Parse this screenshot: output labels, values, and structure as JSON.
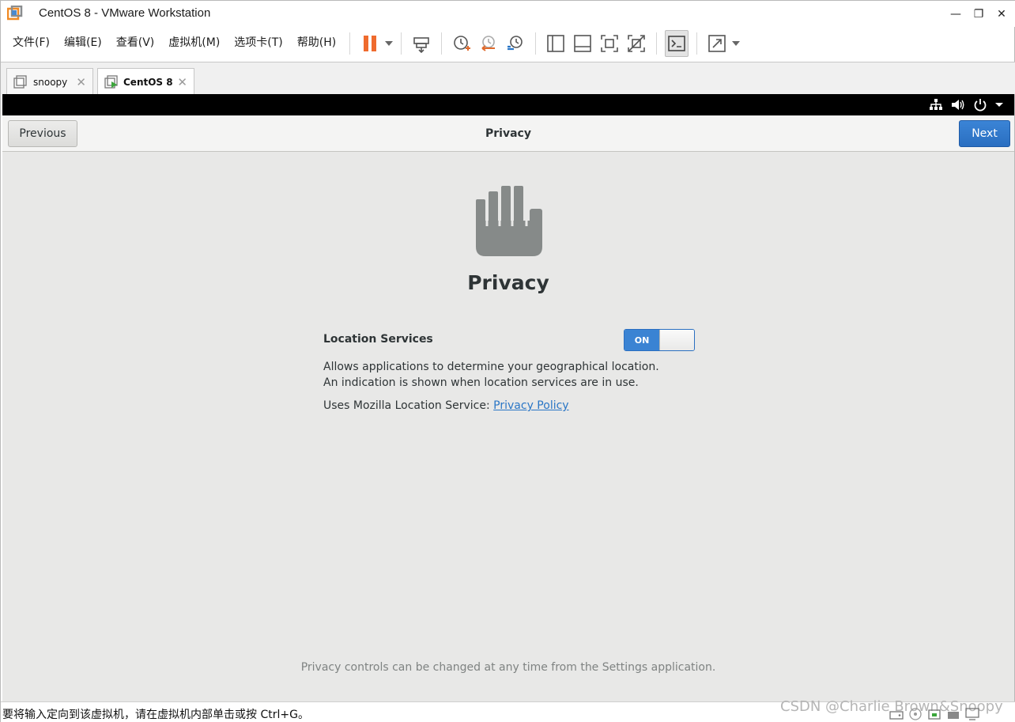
{
  "window": {
    "title": "CentOS 8 - VMware Workstation",
    "controls": {
      "minimize": "—",
      "restore": "❐",
      "close": "✕"
    }
  },
  "menu": [
    {
      "label": "文件(F)"
    },
    {
      "label": "编辑(E)"
    },
    {
      "label": "查看(V)"
    },
    {
      "label": "虚拟机(M)"
    },
    {
      "label": "选项卡(T)"
    },
    {
      "label": "帮助(H)"
    }
  ],
  "toolbar": {
    "icons": [
      "pause-icon",
      "send-keys-icon",
      "snapshot-icon",
      "revert-snapshot-icon",
      "snapshot-manager-icon",
      "show-library-icon",
      "show-thumbnails-icon",
      "fullscreen-icon",
      "unity-icon",
      "console-icon",
      "stretch-icon"
    ],
    "pause_color": "#ef6b2e",
    "snapshot_color": "#e06a2c"
  },
  "tabs": [
    {
      "label": "snoopy",
      "active": false
    },
    {
      "label": "CentOS 8",
      "active": true
    }
  ],
  "vm": {
    "topbar_icons": [
      "network-icon",
      "volume-icon",
      "power-icon",
      "caret-down-icon"
    ],
    "header": {
      "previous_label": "Previous",
      "title": "Privacy",
      "next_label": "Next"
    },
    "page_title": "Privacy",
    "location_services": {
      "label": "Location Services",
      "toggle_state": "ON",
      "description": "Allows applications to determine your geographical location. An indication is shown when location services are in use.",
      "uses_text": "Uses Mozilla Location Service: ",
      "privacy_link": "Privacy Policy"
    },
    "footer_note": "Privacy controls can be changed at any time from the Settings application.",
    "colors": {
      "accent": "#3a83d3",
      "background": "#e8e8e7",
      "hand_icon": "#868a89"
    }
  },
  "statusbar": {
    "text": "要将输入定向到该虚拟机，请在虚拟机内部单击或按 Ctrl+G。",
    "watermark": "CSDN @Charlie Brown&Snoopy"
  }
}
